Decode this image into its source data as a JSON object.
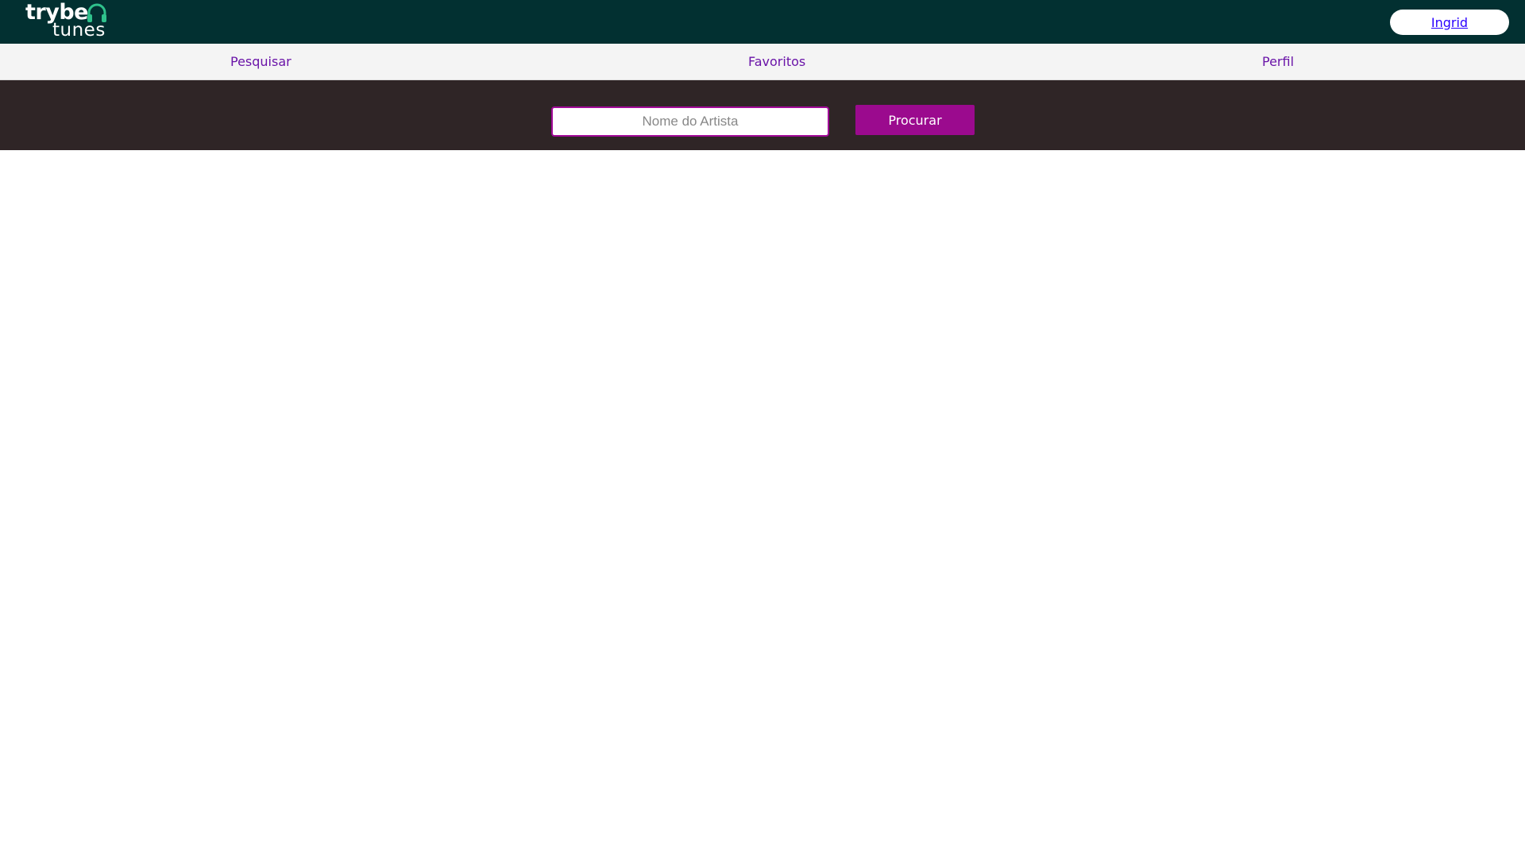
{
  "header": {
    "logo": {
      "line1": "trybe",
      "line2": "tunes",
      "icon": "headphones-icon"
    },
    "user_name": "Ingrid"
  },
  "nav": {
    "items": [
      {
        "label": "Pesquisar"
      },
      {
        "label": "Favoritos"
      },
      {
        "label": "Perfil"
      }
    ]
  },
  "search": {
    "placeholder": "Nome do Artista",
    "value": "",
    "button_label": "Procurar"
  },
  "colors": {
    "header_bg": "#023031",
    "accent_green": "#2fc18c",
    "nav_bg": "#f4f4f4",
    "nav_link": "#6a14a8",
    "search_band_bg": "#2f2526",
    "button_bg": "#9b0a8e"
  }
}
